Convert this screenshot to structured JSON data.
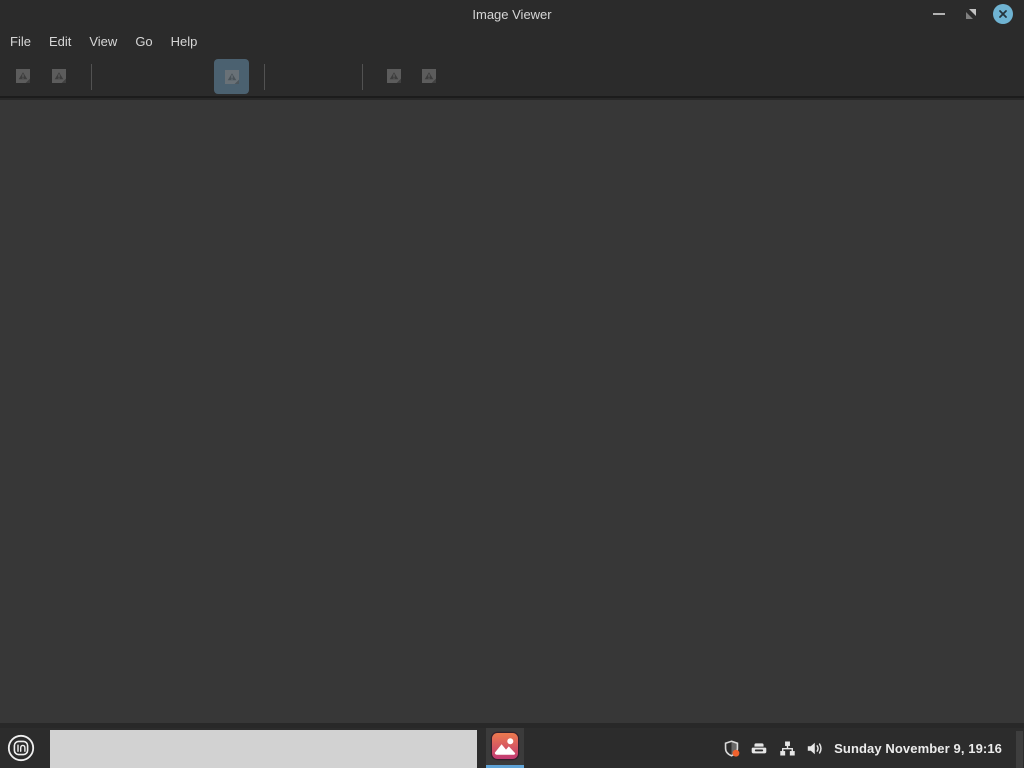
{
  "window": {
    "title": "Image Viewer",
    "controls": {
      "minimize_icon": "minimize-dash",
      "restore_icon": "restore-diagonal-triangles",
      "close_icon": "close-x-in-blue-circle"
    },
    "menu": {
      "items": [
        {
          "label": "File"
        },
        {
          "label": "Edit"
        },
        {
          "label": "View"
        },
        {
          "label": "Go"
        },
        {
          "label": "Help"
        }
      ]
    },
    "toolbar": {
      "buttons": [
        {
          "icon": "missing-image-placeholder-icon",
          "state": "disabled"
        },
        {
          "icon": "missing-image-placeholder-icon",
          "state": "disabled"
        },
        {
          "icon": "missing-image-placeholder-icon",
          "state": "active-toggled"
        },
        {
          "icon": "missing-image-placeholder-icon",
          "state": "disabled"
        },
        {
          "icon": "missing-image-placeholder-icon",
          "state": "disabled"
        }
      ]
    }
  },
  "taskbar": {
    "menu_button_icon": "linux-mint-logo",
    "window_list_item_label": "",
    "active_app_icon": "image-viewer-app-icon",
    "tray_icons": [
      {
        "icon": "shield-update-notifier-icon"
      },
      {
        "icon": "printer-icon"
      },
      {
        "icon": "network-icon"
      },
      {
        "icon": "volume-speaker-icon"
      }
    ],
    "clock": "Sunday November 9, 19:16"
  },
  "colors": {
    "chrome_bg": "#2b2b2b",
    "content_bg": "#373737",
    "taskbar_bg": "#2c2c2c",
    "active_tool_button": "#4b6170",
    "close_button_blue": "#6fb3d2",
    "taskbar_underline_blue": "#5fa3d6",
    "window_list_fill": "#d2d2d2",
    "app_icon_gradient_top": "#ed7a4e",
    "app_icon_gradient_bottom": "#c13a74",
    "tray_alert_orange": "#f0622e"
  }
}
